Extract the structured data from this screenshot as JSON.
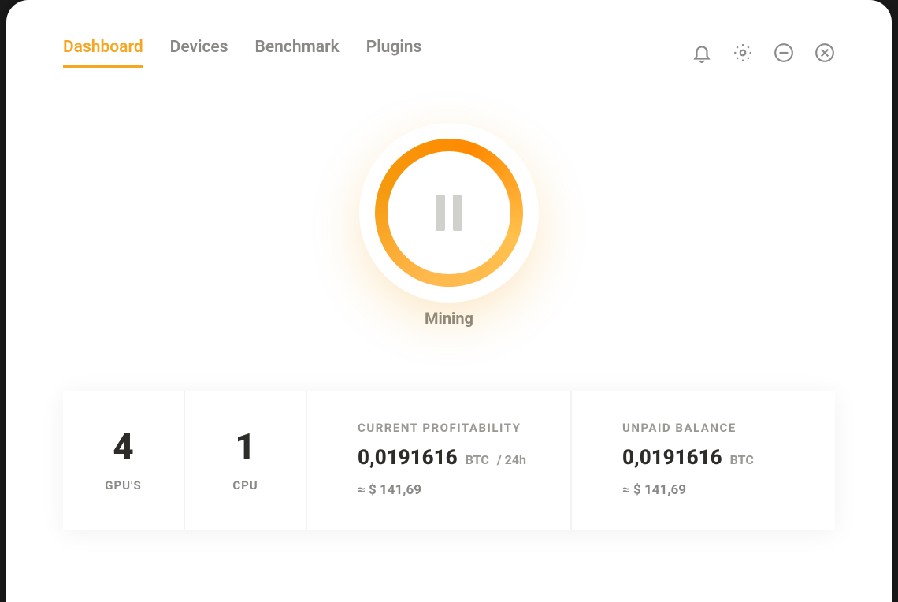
{
  "tabs": {
    "dashboard": "Dashboard",
    "devices": "Devices",
    "benchmark": "Benchmark",
    "plugins": "Plugins"
  },
  "mining": {
    "label": "Mining"
  },
  "cards": {
    "gpu": {
      "value": "4",
      "label": "GPU'S"
    },
    "cpu": {
      "value": "1",
      "label": "CPU"
    },
    "profitability": {
      "title": "CURRENT PROFITABILITY",
      "value": "0,0191616",
      "unit": "BTC",
      "per": "/ 24h",
      "approx": "≈ $ 141,69"
    },
    "balance": {
      "title": "UNPAID BALANCE",
      "value": "0,0191616",
      "unit": "BTC",
      "approx": "≈ $ 141,69"
    }
  }
}
